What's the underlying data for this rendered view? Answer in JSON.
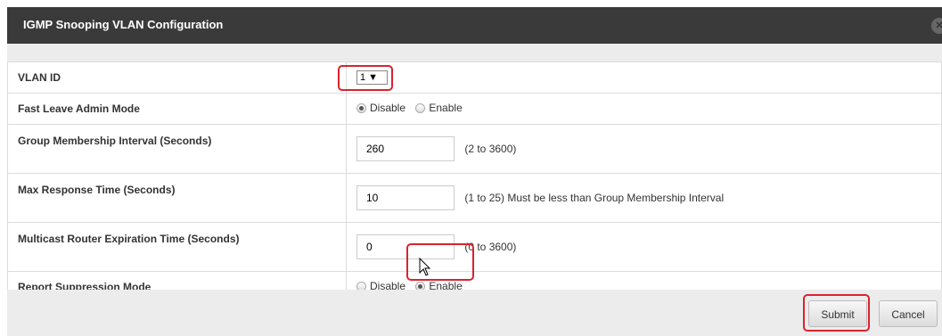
{
  "dialog": {
    "title": "IGMP Snooping VLAN Configuration",
    "close_icon": "close-icon"
  },
  "rows": {
    "vlan_id": {
      "label": "VLAN ID",
      "selected": "1 ▼"
    },
    "fast_leave": {
      "label": "Fast Leave Admin Mode",
      "options": [
        "Disable",
        "Enable"
      ],
      "selected": "Disable"
    },
    "group_membership": {
      "label": "Group Membership Interval  (Seconds)",
      "value": "260",
      "hint": "(2 to 3600)"
    },
    "max_response": {
      "label": "Max Response Time  (Seconds)",
      "value": "10",
      "hint": "(1 to 25)  Must be less than Group Membership Interval"
    },
    "mcast_router": {
      "label": "Multicast Router Expiration Time  (Seconds)",
      "value": "0",
      "hint": "(0 to 3600)"
    },
    "report_suppression": {
      "label": "Report Suppression Mode",
      "options": [
        "Disable",
        "Enable"
      ],
      "selected": "Enable"
    }
  },
  "buttons": {
    "submit": "Submit",
    "cancel": "Cancel"
  },
  "colors": {
    "title_bar": "#3a3a3a",
    "highlight": "#d9232e",
    "panel_bg": "#ececec"
  }
}
